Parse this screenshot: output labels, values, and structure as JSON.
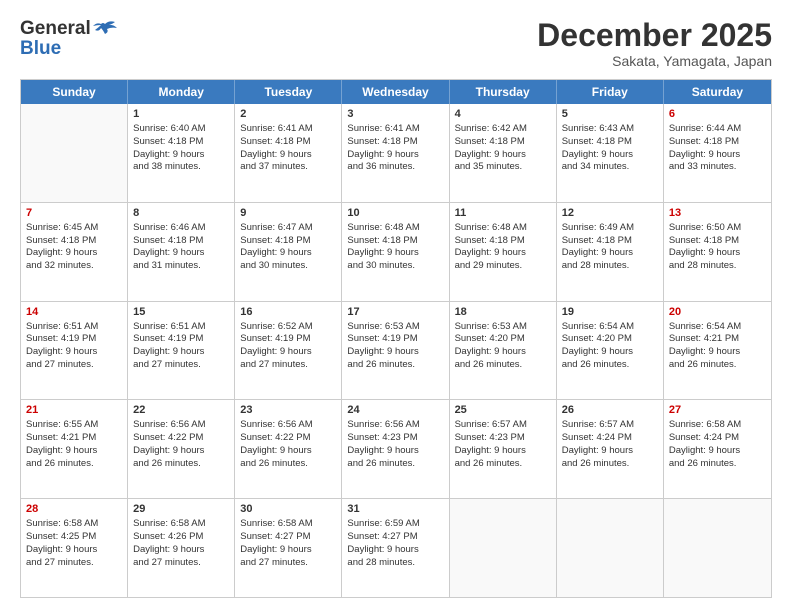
{
  "logo": {
    "line1": "General",
    "line2": "Blue"
  },
  "title": "December 2025",
  "subtitle": "Sakata, Yamagata, Japan",
  "days": [
    "Sunday",
    "Monday",
    "Tuesday",
    "Wednesday",
    "Thursday",
    "Friday",
    "Saturday"
  ],
  "weeks": [
    [
      {
        "num": "",
        "info": ""
      },
      {
        "num": "1",
        "info": "Sunrise: 6:40 AM\nSunset: 4:18 PM\nDaylight: 9 hours\nand 38 minutes."
      },
      {
        "num": "2",
        "info": "Sunrise: 6:41 AM\nSunset: 4:18 PM\nDaylight: 9 hours\nand 37 minutes."
      },
      {
        "num": "3",
        "info": "Sunrise: 6:41 AM\nSunset: 4:18 PM\nDaylight: 9 hours\nand 36 minutes."
      },
      {
        "num": "4",
        "info": "Sunrise: 6:42 AM\nSunset: 4:18 PM\nDaylight: 9 hours\nand 35 minutes."
      },
      {
        "num": "5",
        "info": "Sunrise: 6:43 AM\nSunset: 4:18 PM\nDaylight: 9 hours\nand 34 minutes."
      },
      {
        "num": "6",
        "info": "Sunrise: 6:44 AM\nSunset: 4:18 PM\nDaylight: 9 hours\nand 33 minutes."
      }
    ],
    [
      {
        "num": "7",
        "info": "Sunrise: 6:45 AM\nSunset: 4:18 PM\nDaylight: 9 hours\nand 32 minutes."
      },
      {
        "num": "8",
        "info": "Sunrise: 6:46 AM\nSunset: 4:18 PM\nDaylight: 9 hours\nand 31 minutes."
      },
      {
        "num": "9",
        "info": "Sunrise: 6:47 AM\nSunset: 4:18 PM\nDaylight: 9 hours\nand 30 minutes."
      },
      {
        "num": "10",
        "info": "Sunrise: 6:48 AM\nSunset: 4:18 PM\nDaylight: 9 hours\nand 30 minutes."
      },
      {
        "num": "11",
        "info": "Sunrise: 6:48 AM\nSunset: 4:18 PM\nDaylight: 9 hours\nand 29 minutes."
      },
      {
        "num": "12",
        "info": "Sunrise: 6:49 AM\nSunset: 4:18 PM\nDaylight: 9 hours\nand 28 minutes."
      },
      {
        "num": "13",
        "info": "Sunrise: 6:50 AM\nSunset: 4:18 PM\nDaylight: 9 hours\nand 28 minutes."
      }
    ],
    [
      {
        "num": "14",
        "info": "Sunrise: 6:51 AM\nSunset: 4:19 PM\nDaylight: 9 hours\nand 27 minutes."
      },
      {
        "num": "15",
        "info": "Sunrise: 6:51 AM\nSunset: 4:19 PM\nDaylight: 9 hours\nand 27 minutes."
      },
      {
        "num": "16",
        "info": "Sunrise: 6:52 AM\nSunset: 4:19 PM\nDaylight: 9 hours\nand 27 minutes."
      },
      {
        "num": "17",
        "info": "Sunrise: 6:53 AM\nSunset: 4:19 PM\nDaylight: 9 hours\nand 26 minutes."
      },
      {
        "num": "18",
        "info": "Sunrise: 6:53 AM\nSunset: 4:20 PM\nDaylight: 9 hours\nand 26 minutes."
      },
      {
        "num": "19",
        "info": "Sunrise: 6:54 AM\nSunset: 4:20 PM\nDaylight: 9 hours\nand 26 minutes."
      },
      {
        "num": "20",
        "info": "Sunrise: 6:54 AM\nSunset: 4:21 PM\nDaylight: 9 hours\nand 26 minutes."
      }
    ],
    [
      {
        "num": "21",
        "info": "Sunrise: 6:55 AM\nSunset: 4:21 PM\nDaylight: 9 hours\nand 26 minutes."
      },
      {
        "num": "22",
        "info": "Sunrise: 6:56 AM\nSunset: 4:22 PM\nDaylight: 9 hours\nand 26 minutes."
      },
      {
        "num": "23",
        "info": "Sunrise: 6:56 AM\nSunset: 4:22 PM\nDaylight: 9 hours\nand 26 minutes."
      },
      {
        "num": "24",
        "info": "Sunrise: 6:56 AM\nSunset: 4:23 PM\nDaylight: 9 hours\nand 26 minutes."
      },
      {
        "num": "25",
        "info": "Sunrise: 6:57 AM\nSunset: 4:23 PM\nDaylight: 9 hours\nand 26 minutes."
      },
      {
        "num": "26",
        "info": "Sunrise: 6:57 AM\nSunset: 4:24 PM\nDaylight: 9 hours\nand 26 minutes."
      },
      {
        "num": "27",
        "info": "Sunrise: 6:58 AM\nSunset: 4:24 PM\nDaylight: 9 hours\nand 26 minutes."
      }
    ],
    [
      {
        "num": "28",
        "info": "Sunrise: 6:58 AM\nSunset: 4:25 PM\nDaylight: 9 hours\nand 27 minutes."
      },
      {
        "num": "29",
        "info": "Sunrise: 6:58 AM\nSunset: 4:26 PM\nDaylight: 9 hours\nand 27 minutes."
      },
      {
        "num": "30",
        "info": "Sunrise: 6:58 AM\nSunset: 4:27 PM\nDaylight: 9 hours\nand 27 minutes."
      },
      {
        "num": "31",
        "info": "Sunrise: 6:59 AM\nSunset: 4:27 PM\nDaylight: 9 hours\nand 28 minutes."
      },
      {
        "num": "",
        "info": ""
      },
      {
        "num": "",
        "info": ""
      },
      {
        "num": "",
        "info": ""
      }
    ]
  ]
}
